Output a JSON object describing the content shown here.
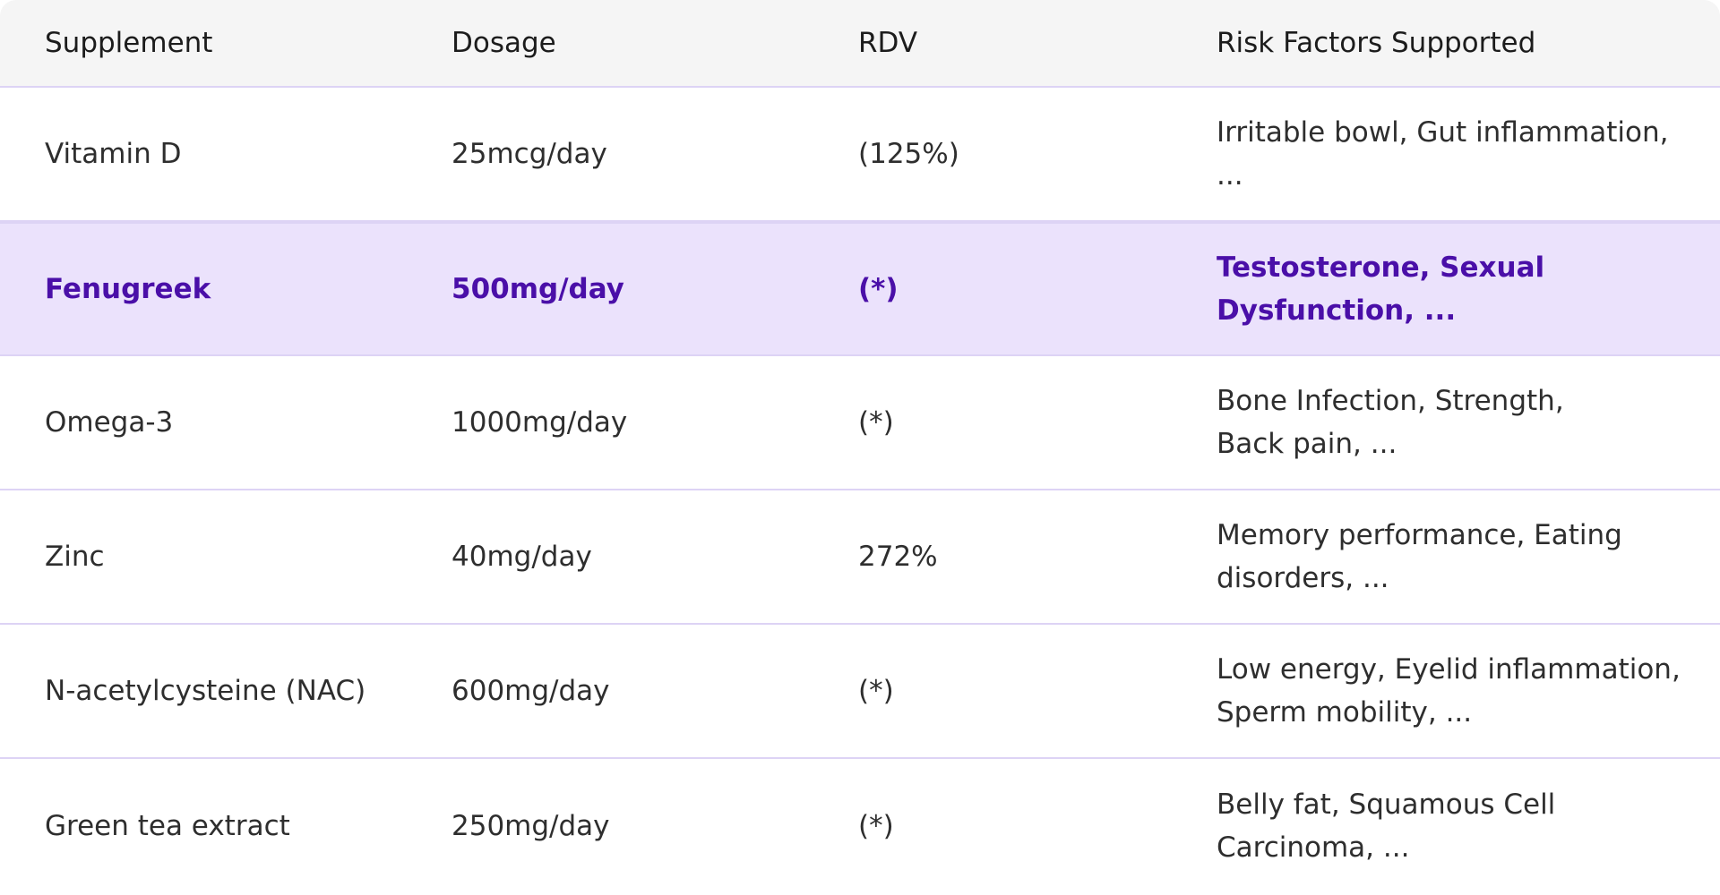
{
  "table": {
    "columns": [
      "Supplement",
      "Dosage",
      "RDV",
      "Risk Factors Supported"
    ],
    "rows": [
      {
        "supplement": "Vitamin D",
        "dosage": "25mcg/day",
        "rdv": "(125%)",
        "risk_line1": "Irritable bowl, Gut inflammation, ...",
        "risk_line2": ""
      },
      {
        "supplement": "Fenugreek",
        "dosage": "500mg/day",
        "rdv": "(*)",
        "risk_line1": "Testosterone, Sexual",
        "risk_line2": "Dysfunction, ..."
      },
      {
        "supplement": "Omega-3",
        "dosage": "1000mg/day",
        "rdv": "(*)",
        "risk_line1": "Bone Infection, Strength,",
        "risk_line2": "Back pain, ..."
      },
      {
        "supplement": "Zinc",
        "dosage": "40mg/day",
        "rdv": "272%",
        "risk_line1": "Memory performance, Eating",
        "risk_line2": "disorders, ..."
      },
      {
        "supplement": "N-acetylcysteine (NAC)",
        "dosage": "600mg/day",
        "rdv": "(*)",
        "risk_line1": "Low energy, Eyelid inflammation,",
        "risk_line2": "Sperm mobility, ..."
      },
      {
        "supplement": "Green tea extract",
        "dosage": "250mg/day",
        "rdv": "(*)",
        "risk_line1": "Belly fat, Squamous Cell",
        "risk_line2": "Carcinoma, ..."
      }
    ]
  },
  "colors": {
    "header_bg": "#f5f5f5",
    "selected_bg": "#ebe2fc",
    "selected_text": "#4a0fa8",
    "divider": "#ddd3f5"
  }
}
